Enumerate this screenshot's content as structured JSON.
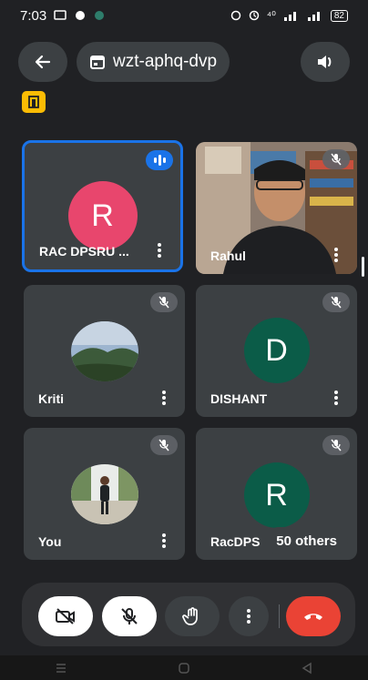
{
  "status_bar": {
    "time": "7:03",
    "network": "⁴⁰",
    "battery": "82"
  },
  "top_bar": {
    "meeting_code": "wzt-aphq-dvp"
  },
  "tiles": [
    {
      "name": "RAC DPSRU ...",
      "initial": "R",
      "avatar_color": "#e8466d",
      "state": "speaking"
    },
    {
      "name": "Rahul",
      "initial": "",
      "avatar_color": "",
      "state": "muted"
    },
    {
      "name": "Kriti",
      "initial": "",
      "avatar_color": "",
      "state": "muted"
    },
    {
      "name": "DISHANT",
      "initial": "D",
      "avatar_color": "#0b5c48",
      "state": "muted"
    },
    {
      "name": "You",
      "initial": "",
      "avatar_color": "",
      "state": "muted"
    },
    {
      "name": "RacDPS",
      "initial": "R",
      "avatar_color": "#0b5c48",
      "state": "muted"
    }
  ],
  "others_chip": "50 others",
  "colors": {
    "background": "#202124",
    "tile": "#3c4043",
    "active_border": "#1a73e8",
    "end_call": "#ea4335",
    "host_badge": "#fbbc04"
  },
  "icons": {
    "back": "arrow-left-icon",
    "meeting": "calendar-icon",
    "audio": "speaker-icon",
    "host": "host-controls-icon",
    "camera": "camera-off-icon",
    "mic": "mic-off-icon",
    "hand": "raise-hand-icon",
    "more": "more-vert-icon",
    "end": "end-call-icon"
  }
}
